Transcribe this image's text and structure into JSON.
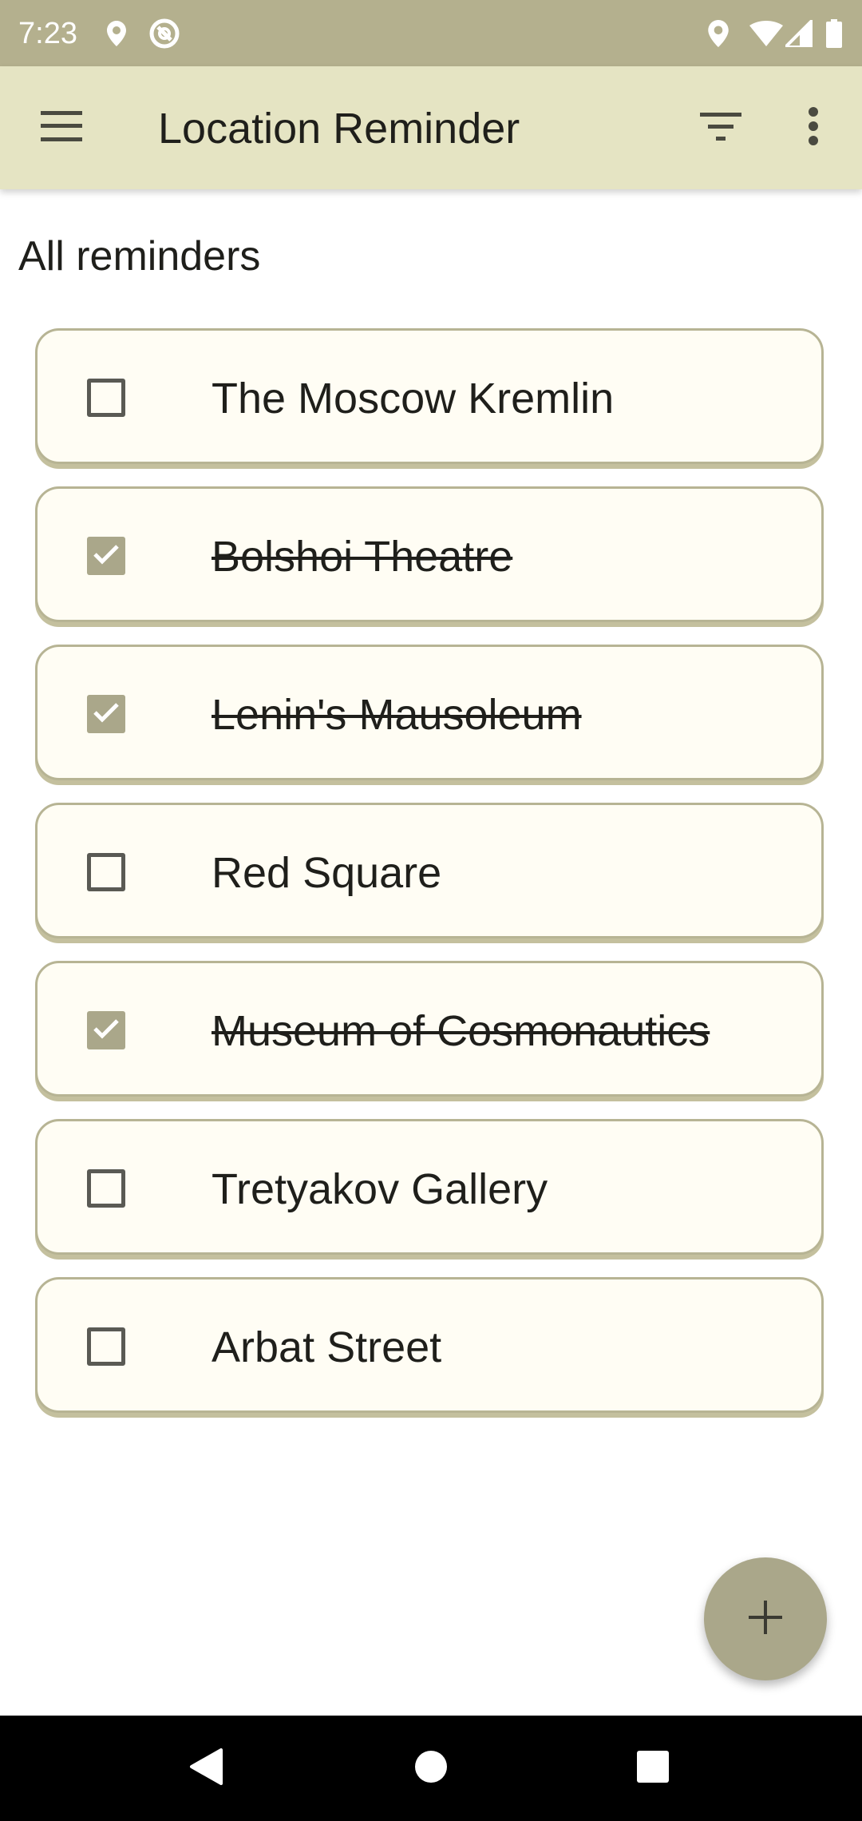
{
  "status_bar": {
    "time": "7:23",
    "left_icons": [
      "location-pin-icon",
      "at-sign-icon"
    ],
    "right_icons": [
      "location-pin-icon",
      "wifi-icon",
      "cell-signal-icon",
      "battery-icon"
    ]
  },
  "app_bar": {
    "title": "Location Reminder",
    "menu_icon": "hamburger-menu-icon",
    "filter_icon": "filter-icon",
    "more_icon": "more-vertical-icon"
  },
  "section_title": "All reminders",
  "reminders": [
    {
      "title": "The Moscow Kremlin",
      "completed": false
    },
    {
      "title": "Bolshoi Theatre",
      "completed": true
    },
    {
      "title": "Lenin's Mausoleum",
      "completed": true
    },
    {
      "title": "Red Square",
      "completed": false
    },
    {
      "title": "Museum of Cosmonautics",
      "completed": true
    },
    {
      "title": "Tretyakov Gallery",
      "completed": false
    },
    {
      "title": "Arbat Street",
      "completed": false
    }
  ],
  "fab": {
    "icon": "plus-icon"
  },
  "nav_bar": {
    "icons": [
      "back-icon",
      "home-icon",
      "recents-icon"
    ]
  },
  "colors": {
    "status_bar": "#b4b08e",
    "app_bar": "#e5e4c3",
    "card_background": "#fffdf4",
    "card_border": "#b7b494",
    "checkbox_checked": "#aaa78a",
    "fab": "#aaa78a",
    "nav_bar": "#000000"
  }
}
